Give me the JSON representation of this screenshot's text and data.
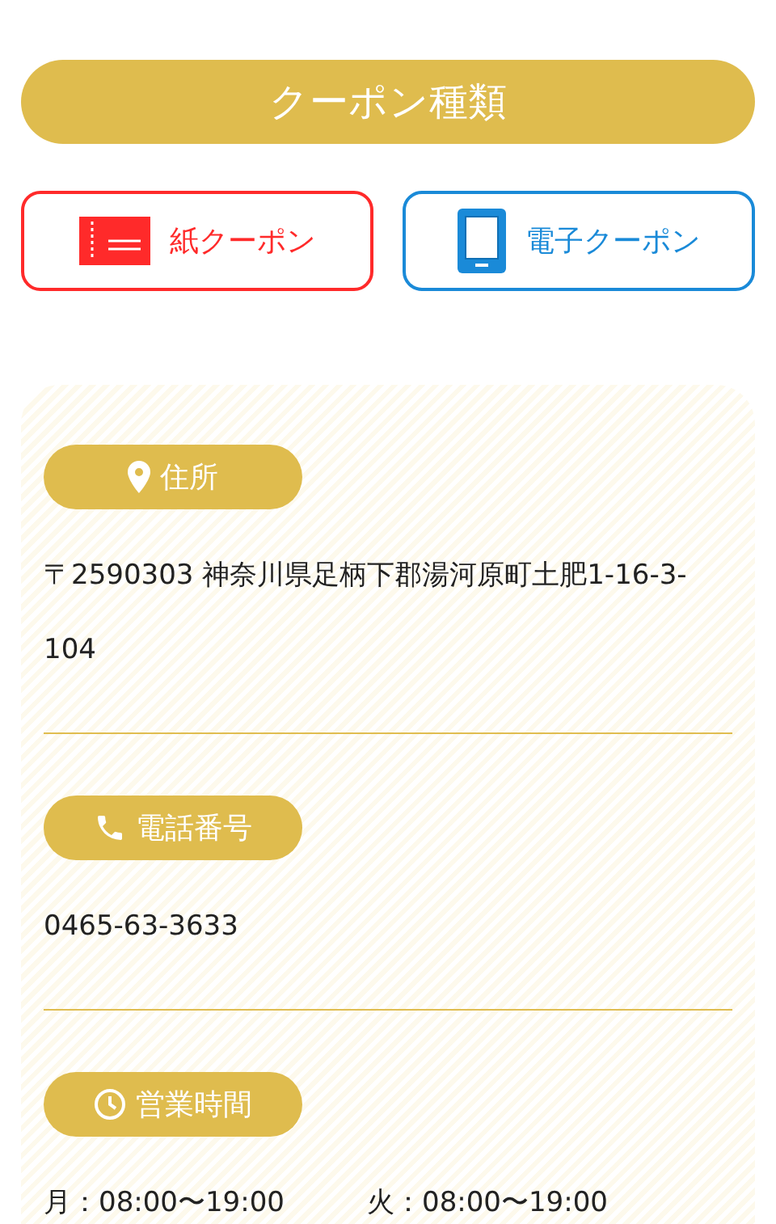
{
  "header": {
    "title": "クーポン種類"
  },
  "coupon_types": [
    {
      "kind": "paper",
      "label": "紙クーポン",
      "color": "#ff2a2a"
    },
    {
      "kind": "digital",
      "label": "電子クーポン",
      "color": "#1a8ad8"
    }
  ],
  "sections": [
    {
      "kind": "address",
      "title": "住所",
      "lines": [
        "〒2590303 神奈川県足柄下郡湯河原町土肥1-16-3-104"
      ]
    },
    {
      "kind": "phone",
      "title": "電話番号",
      "lines": [
        "0465-63-3633"
      ]
    },
    {
      "kind": "hours",
      "title": "営業時間",
      "lines": [
        "月：08:00〜19:00",
        "火：08:00〜19:00"
      ]
    }
  ]
}
